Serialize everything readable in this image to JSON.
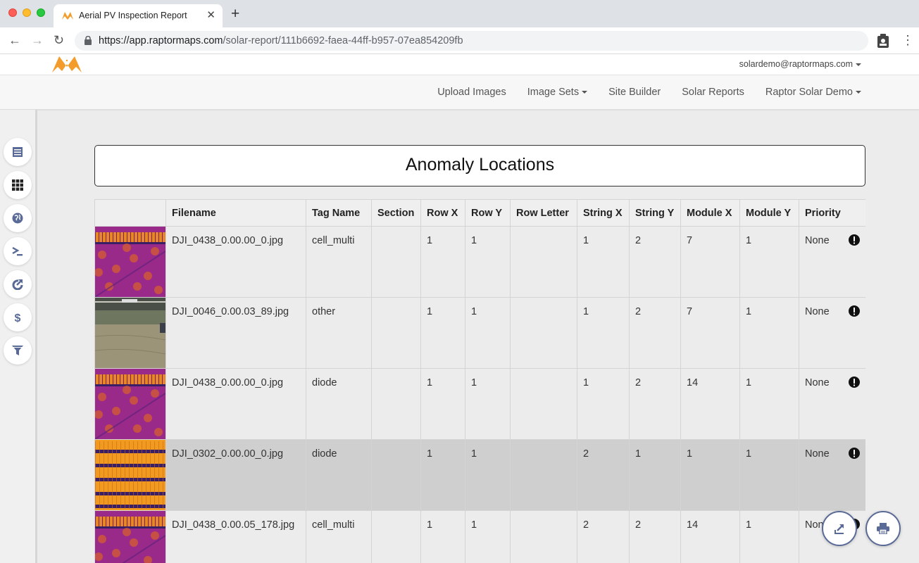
{
  "browser": {
    "tab_title": "Aerial PV Inspection Report",
    "url_host": "https://app.raptormaps.com",
    "url_path": "/solar-report/111b6692-faea-44ff-b957-07ea854209fb"
  },
  "header": {
    "user_email": "solardemo@raptormaps.com",
    "nav": [
      "Upload Images",
      "Image Sets",
      "Site Builder",
      "Solar Reports",
      "Raptor Solar Demo"
    ]
  },
  "sidebar": {
    "icons": [
      "report-icon",
      "grid-icon",
      "globe-icon",
      "terminal-icon",
      "share-icon",
      "dollar-icon",
      "filter-icon"
    ]
  },
  "main": {
    "title": "Anomaly Locations",
    "columns": [
      "",
      "Filename",
      "Tag Name",
      "Section",
      "Row X",
      "Row Y",
      "Row Letter",
      "String X",
      "String Y",
      "Module X",
      "Module Y",
      "Priority"
    ],
    "rows": [
      {
        "image": "thermal",
        "filename": "DJI_0438_0.00.00_0.jpg",
        "tag": "cell_multi",
        "section": "",
        "row_x": "1",
        "row_y": "1",
        "row_letter": "",
        "string_x": "1",
        "string_y": "2",
        "module_x": "7",
        "module_y": "1",
        "priority": "None"
      },
      {
        "image": "visual",
        "filename": "DJI_0046_0.00.03_89.jpg",
        "tag": "other",
        "section": "",
        "row_x": "1",
        "row_y": "1",
        "row_letter": "",
        "string_x": "1",
        "string_y": "2",
        "module_x": "7",
        "module_y": "1",
        "priority": "None"
      },
      {
        "image": "thermal",
        "filename": "DJI_0438_0.00.00_0.jpg",
        "tag": "diode",
        "section": "",
        "row_x": "1",
        "row_y": "1",
        "row_letter": "",
        "string_x": "1",
        "string_y": "2",
        "module_x": "14",
        "module_y": "1",
        "priority": "None"
      },
      {
        "image": "thermal-rows",
        "filename": "DJI_0302_0.00.00_0.jpg",
        "tag": "diode",
        "section": "",
        "row_x": "1",
        "row_y": "1",
        "row_letter": "",
        "string_x": "2",
        "string_y": "1",
        "module_x": "1",
        "module_y": "1",
        "priority": "None"
      },
      {
        "image": "thermal",
        "filename": "DJI_0438_0.00.05_178.jpg",
        "tag": "cell_multi",
        "section": "",
        "row_x": "1",
        "row_y": "1",
        "row_letter": "",
        "string_x": "2",
        "string_y": "2",
        "module_x": "14",
        "module_y": "1",
        "priority": "None"
      }
    ]
  },
  "colors": {
    "accent": "#5a6a96",
    "logo": "#f39c2b",
    "row_highlight": "#cfcfcf"
  }
}
